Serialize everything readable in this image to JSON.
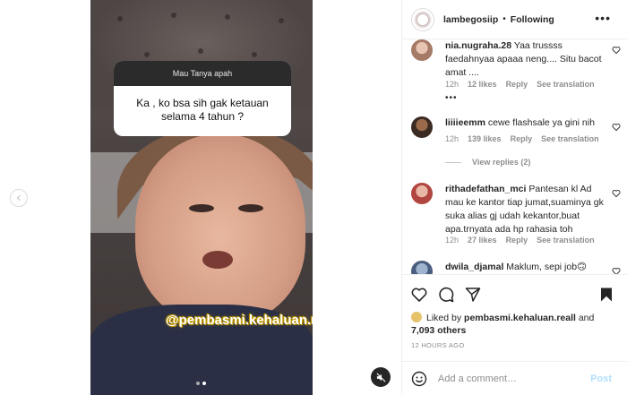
{
  "header": {
    "username": "lambegosiip",
    "separator": "•",
    "follow_status": "Following",
    "more": "•••"
  },
  "story_question": {
    "prompt": "Mau Tanya apah",
    "question": "Ka , ko bsa sih gak ketauan selama 4 tahun ?"
  },
  "watermark": "@pembasmi.kehaluan.reall",
  "comments": [
    {
      "username": "nia.nugraha.28",
      "text": "Yaa trussss faedahnyaa apaaa neng.... Situ bacot amat ....",
      "time": "12h",
      "likes": "12 likes",
      "reply": "Reply",
      "translate": "See translation"
    },
    {
      "username": "liiiieemm",
      "text": "cewe flashsale ya gini nih",
      "time": "12h",
      "likes": "139 likes",
      "reply": "Reply",
      "translate": "See translation"
    },
    {
      "username": "rithadefathan_mci",
      "text": "Pantesan kl Ad mau ke kantor tiap jumat,suaminya gk suka alias gj udah kekantor,buat apa.trnyata ada hp rahasia toh",
      "time": "12h",
      "likes": "27 likes",
      "reply": "Reply",
      "translate": "See translation"
    },
    {
      "username": "dwila_djamal",
      "text": "Maklum, sepi job🙃"
    }
  ],
  "view_replies": "View replies (2)",
  "liked_by": {
    "prefix": "Liked by ",
    "user": "pembasmi.kehaluan.reall",
    "and": " and",
    "others": "7,093 others"
  },
  "timestamp": "12 HOURS AGO",
  "add_comment": {
    "placeholder": "Add a comment…",
    "post": "Post"
  },
  "colors": {
    "link_blue": "#0095f6",
    "post_disabled": "#b2dffc",
    "secondary_text": "#8e8e8e"
  }
}
